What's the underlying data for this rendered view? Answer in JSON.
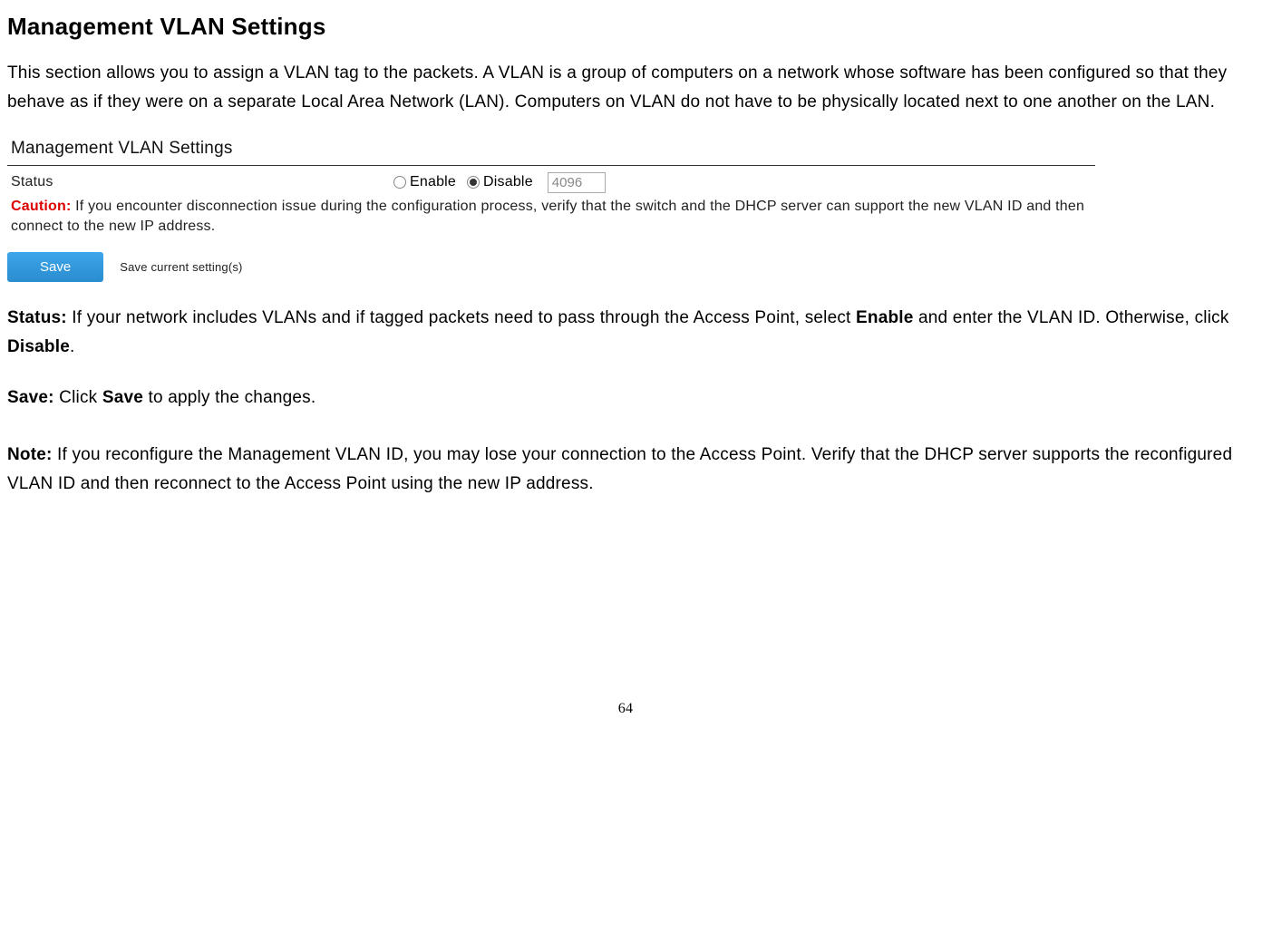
{
  "header": {
    "title": "Management VLAN Settings"
  },
  "intro": "This section allows you to assign a VLAN tag to the packets. A VLAN is a group of computers on a network whose software has been configured so that they behave as if they were on a separate Local Area Network (LAN). Computers on VLAN do not have to be physically located next to one another on the LAN.",
  "panel": {
    "title": "Management VLAN Settings",
    "status_label": "Status",
    "enable_label": "Enable",
    "disable_label": "Disable",
    "vlan_id_value": "4096",
    "caution_label": "Caution:",
    "caution_text": "  If you encounter disconnection issue during the configuration process, verify that the switch and the DHCP server can support the new VLAN ID and then connect to the new IP address.",
    "save_button": "Save",
    "save_note": "Save current setting(s)"
  },
  "status_desc": {
    "label": "Status:",
    "text_before_enable": " If your network includes VLANs and if tagged packets need to pass through the Access Point, select ",
    "enable_word": "Enable",
    "text_middle": " and enter the VLAN ID. Otherwise, click ",
    "disable_word": "Disable",
    "text_end": "."
  },
  "save_desc": {
    "label": "Save:",
    "text_before": " Click ",
    "save_word": "Save",
    "text_after": " to apply the changes."
  },
  "note_desc": {
    "label": "Note:",
    "text": " If you reconfigure the Management VLAN ID, you may lose your connection to the Access Point. Verify that the DHCP server supports the reconfigured VLAN ID and then reconnect to the Access Point using the new IP address."
  },
  "page_number": "64"
}
